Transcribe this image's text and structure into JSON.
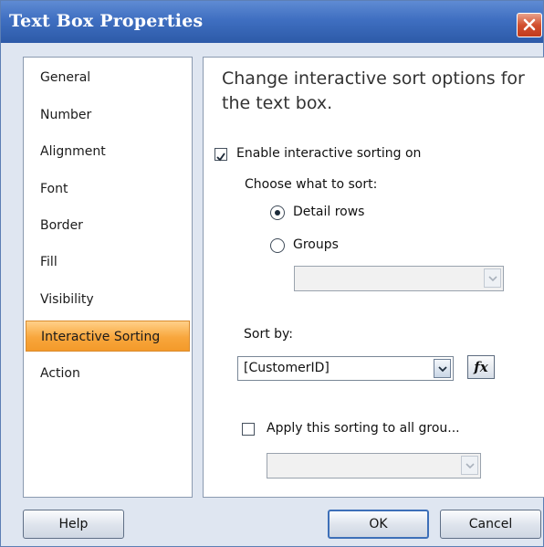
{
  "window": {
    "title": "Text Box Properties"
  },
  "nav": {
    "items": [
      {
        "label": "General"
      },
      {
        "label": "Number"
      },
      {
        "label": "Alignment"
      },
      {
        "label": "Font"
      },
      {
        "label": "Border"
      },
      {
        "label": "Fill"
      },
      {
        "label": "Visibility"
      },
      {
        "label": "Interactive Sorting",
        "selected": true
      },
      {
        "label": "Action"
      }
    ]
  },
  "content": {
    "heading": "Change interactive sort options for the text box.",
    "enable_sorting": {
      "label": "Enable interactive sorting on",
      "checked": true
    },
    "choose_label": "Choose what to sort:",
    "detail_rows": {
      "label": "Detail rows",
      "selected": true
    },
    "groups": {
      "label": "Groups",
      "selected": false
    },
    "groups_combo": {
      "value": ""
    },
    "sort_by_label": "Sort by:",
    "sort_by_combo": {
      "value": "[CustomerID]"
    },
    "fx_label": "fx",
    "apply_all": {
      "label": "Apply this sorting to all grou...",
      "checked": false
    },
    "apply_combo": {
      "value": ""
    }
  },
  "buttons": {
    "help": "Help",
    "ok": "OK",
    "cancel": "Cancel"
  }
}
